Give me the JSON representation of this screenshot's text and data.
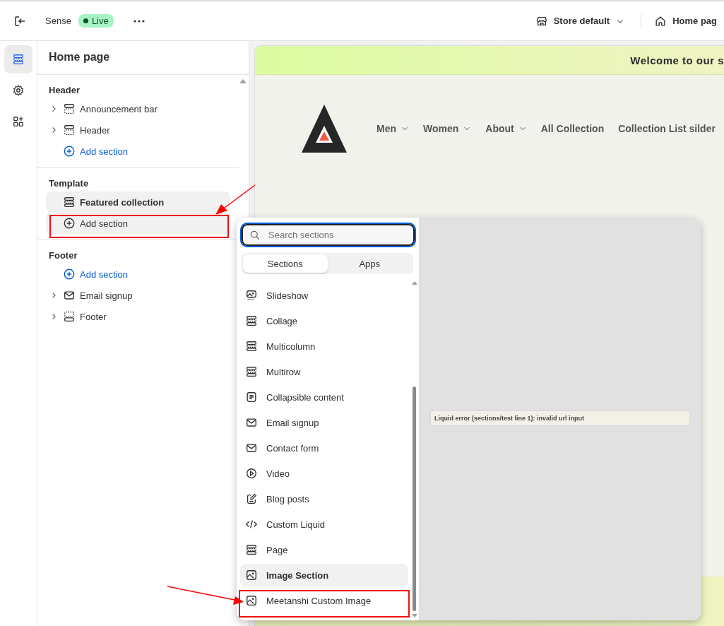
{
  "topbar": {
    "theme": "Sense",
    "status": "Live",
    "store": "Store default",
    "page": "Home pag"
  },
  "sidebar": {
    "title": "Home page",
    "groups": [
      {
        "title": "Header",
        "rows": [
          {
            "label": "Announcement bar",
            "kind": "header",
            "expandable": true,
            "selected": false
          },
          {
            "label": "Header",
            "kind": "header",
            "expandable": true,
            "selected": false
          },
          {
            "label": "Add section",
            "kind": "add",
            "expandable": false,
            "selected": false
          }
        ]
      },
      {
        "title": "Template",
        "rows": [
          {
            "label": "Featured collection",
            "kind": "section",
            "expandable": false,
            "selected": true
          },
          {
            "label": "Add section",
            "kind": "add",
            "expandable": false,
            "selected": true
          }
        ]
      },
      {
        "title": "Footer",
        "rows": [
          {
            "label": "Add section",
            "kind": "add",
            "expandable": false,
            "selected": false
          },
          {
            "label": "Email signup",
            "kind": "mail",
            "expandable": true,
            "selected": false
          },
          {
            "label": "Footer",
            "kind": "footer",
            "expandable": true,
            "selected": false
          }
        ]
      }
    ]
  },
  "preview": {
    "announcement": "Welcome to our s",
    "nav": [
      {
        "label": "Men",
        "dropdown": true
      },
      {
        "label": "Women",
        "dropdown": true
      },
      {
        "label": "About",
        "dropdown": true
      },
      {
        "label": "All Collection",
        "dropdown": false
      },
      {
        "label": "Collection List silder",
        "dropdown": false
      }
    ]
  },
  "picker": {
    "search": {
      "placeholder": "Search sections"
    },
    "tabs": [
      {
        "label": "Sections",
        "selected": true
      },
      {
        "label": "Apps",
        "selected": false
      }
    ],
    "items": [
      {
        "label": "Slideshow",
        "kind": "image-dashed",
        "selected": false
      },
      {
        "label": "Collage",
        "kind": "section",
        "selected": false
      },
      {
        "label": "Multicolumn",
        "kind": "section",
        "selected": false
      },
      {
        "label": "Multirow",
        "kind": "section",
        "selected": false
      },
      {
        "label": "Collapsible content",
        "kind": "text",
        "selected": false
      },
      {
        "label": "Email signup",
        "kind": "mail",
        "selected": false
      },
      {
        "label": "Contact form",
        "kind": "mail",
        "selected": false
      },
      {
        "label": "Video",
        "kind": "video",
        "selected": false
      },
      {
        "label": "Blog posts",
        "kind": "blog",
        "selected": false
      },
      {
        "label": "Custom Liquid",
        "kind": "code",
        "selected": false
      },
      {
        "label": "Page",
        "kind": "section",
        "selected": false
      },
      {
        "label": "Image Section",
        "kind": "image",
        "selected": true
      },
      {
        "label": "Meetanshi Custom Image",
        "kind": "image",
        "selected": false
      }
    ],
    "preview_error": "Liquid error (sections/test line 1): invalid url input"
  }
}
